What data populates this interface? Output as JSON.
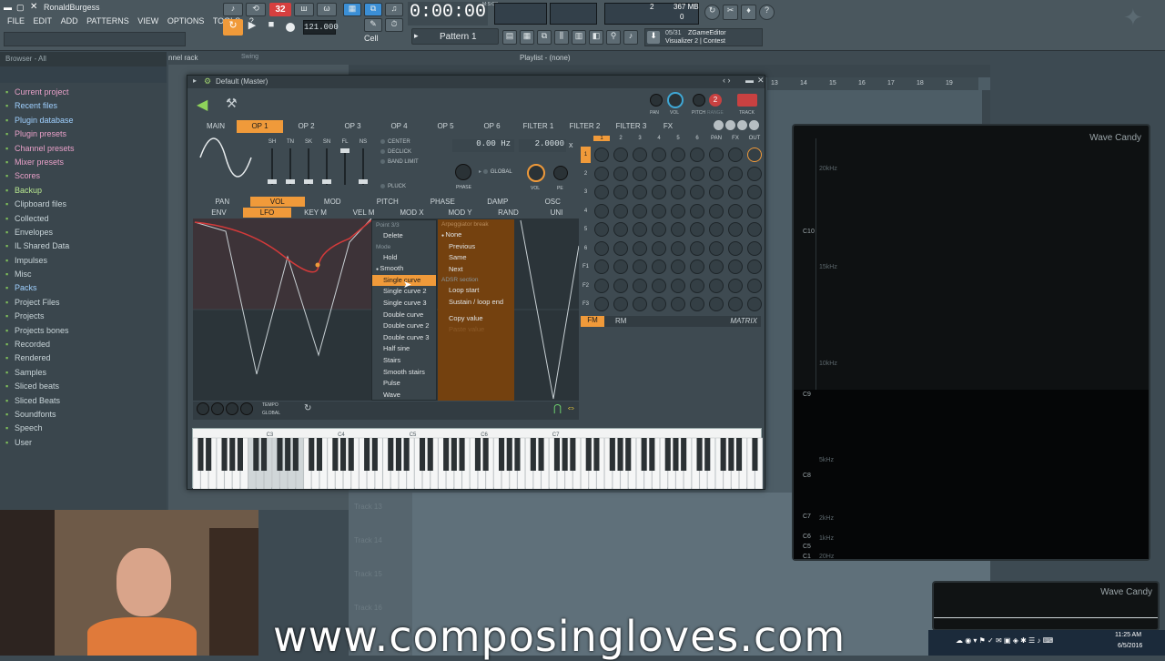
{
  "menu": [
    "FILE",
    "EDIT",
    "ADD",
    "PATTERNS",
    "VIEW",
    "OPTIONS",
    "TOOLS",
    "?"
  ],
  "user": "RonaldBurgess",
  "time": "0:00:00",
  "time_unit": "M:S:CS",
  "tempo": "121.000",
  "pattern": "Pattern 1",
  "snap": "Cell",
  "cpu": "2",
  "mem": "367 MB",
  "poly": "0",
  "hint_date": "05/31",
  "hint_line1": "ZGameEditor",
  "hint_line2": "Visualizer 2 | Contest",
  "step": "32",
  "browser": {
    "header": "Browser - All",
    "items": [
      {
        "label": "Current project",
        "color": "#e8a0c8"
      },
      {
        "label": "Recent files",
        "color": "#9fd0ff"
      },
      {
        "label": "Plugin database",
        "color": "#9fd0ff"
      },
      {
        "label": "Plugin presets",
        "color": "#e8a0c8"
      },
      {
        "label": "Channel presets",
        "color": "#e8a0c8"
      },
      {
        "label": "Mixer presets",
        "color": "#e8a0c8"
      },
      {
        "label": "Scores",
        "color": "#e8a0c8"
      },
      {
        "label": "Backup",
        "color": "#b8e890"
      },
      {
        "label": "Clipboard files",
        "color": "#c8d4d8"
      },
      {
        "label": "Collected",
        "color": "#c8d4d8"
      },
      {
        "label": "Envelopes",
        "color": "#c8d4d8"
      },
      {
        "label": "IL Shared Data",
        "color": "#c8d4d8"
      },
      {
        "label": "Impulses",
        "color": "#c8d4d8"
      },
      {
        "label": "Misc",
        "color": "#c8d4d8"
      },
      {
        "label": "Packs",
        "color": "#9fd0ff"
      },
      {
        "label": "Project Files",
        "color": "#c8d4d8"
      },
      {
        "label": "Projects",
        "color": "#c8d4d8"
      },
      {
        "label": "Projects bones",
        "color": "#c8d4d8"
      },
      {
        "label": "Recorded",
        "color": "#c8d4d8"
      },
      {
        "label": "Rendered",
        "color": "#c8d4d8"
      },
      {
        "label": "Samples",
        "color": "#c8d4d8"
      },
      {
        "label": "Sliced beats",
        "color": "#c8d4d8"
      },
      {
        "label": "Sliced Beats",
        "color": "#c8d4d8"
      },
      {
        "label": "Soundfonts",
        "color": "#c8d4d8"
      },
      {
        "label": "Speech",
        "color": "#c8d4d8"
      },
      {
        "label": "User",
        "color": "#c8d4d8"
      }
    ]
  },
  "channel_rack_title": "nnel rack",
  "swing": "Swing",
  "playlist_title": "Playlist - (none)",
  "playlist_bars": [
    "13",
    "14",
    "15",
    "16",
    "17",
    "18",
    "19"
  ],
  "tracks": [
    "Track 13",
    "Track 14",
    "Track 15",
    "Track 16"
  ],
  "plugin": {
    "title": "Default (Master)",
    "tabs": [
      "MAIN",
      "OP 1",
      "OP 2",
      "OP 3",
      "OP 4",
      "OP 5",
      "OP 6",
      "FILTER 1",
      "FILTER 2",
      "FILTER 3",
      "FX"
    ],
    "active_tab": "OP 1",
    "knob_labels": [
      "PAN",
      "VOL",
      "PITCH",
      "TRACK"
    ],
    "pitch_sub": "RANGE",
    "wave_labels": [
      "SH",
      "TN",
      "SK",
      "SN",
      "FL",
      "NS"
    ],
    "options": [
      "CENTER",
      "DECLICK",
      "BAND LIMIT",
      "PLUCK"
    ],
    "freq": "0.00 Hz",
    "ratio": "2.0000",
    "ratio_x": "x",
    "global": "GLOBAL",
    "phase": "PHASE",
    "vol": "VOL",
    "pe": "PE",
    "mod_row": [
      "PAN",
      "VOL",
      "MOD",
      "PITCH",
      "PHASE",
      "DAMP",
      "OSC"
    ],
    "env_row": [
      "ENV",
      "LFO",
      "KEY M",
      "VEL M",
      "MOD X",
      "MOD Y",
      "RAND",
      "UNI"
    ],
    "matrix_cols": [
      "1",
      "2",
      "3",
      "4",
      "5",
      "6",
      "PAN",
      "FX",
      "OUT"
    ],
    "matrix_rows": [
      "1",
      "2",
      "3",
      "4",
      "5",
      "6",
      "F1",
      "F2",
      "F3"
    ],
    "fm": "FM",
    "rm": "RM",
    "matrix": "MATRIX",
    "footer_left": [
      "TEMPO",
      "GLOBAL"
    ],
    "piano_labels": [
      "C3",
      "C4",
      "C5",
      "C6",
      "C7"
    ]
  },
  "ctx_menu": {
    "header": "Point 3/3",
    "col1": [
      {
        "t": "Delete",
        "type": "item"
      },
      {
        "t": "Mode",
        "type": "head"
      },
      {
        "t": "Hold",
        "type": "item"
      },
      {
        "t": "Smooth",
        "type": "item",
        "sel": true
      },
      {
        "t": "Single curve",
        "type": "item",
        "hl": true
      },
      {
        "t": "Single curve 2",
        "type": "item"
      },
      {
        "t": "Single curve 3",
        "type": "item"
      },
      {
        "t": "Double curve",
        "type": "item"
      },
      {
        "t": "Double curve 2",
        "type": "item"
      },
      {
        "t": "Double curve 3",
        "type": "item"
      },
      {
        "t": "Half sine",
        "type": "item"
      },
      {
        "t": "Stairs",
        "type": "item"
      },
      {
        "t": "Smooth stairs",
        "type": "item"
      },
      {
        "t": "Pulse",
        "type": "item"
      },
      {
        "t": "Wave",
        "type": "item"
      }
    ],
    "col2_header": "Arpeggiator break",
    "col2": [
      {
        "t": "None",
        "type": "item",
        "sel": true
      },
      {
        "t": "Previous",
        "type": "item"
      },
      {
        "t": "Same",
        "type": "item"
      },
      {
        "t": "Next",
        "type": "item"
      },
      {
        "t": "ADSR section",
        "type": "head"
      },
      {
        "t": "Loop start",
        "type": "item"
      },
      {
        "t": "Sustain / loop end",
        "type": "item"
      },
      {
        "t": "",
        "type": "sp"
      },
      {
        "t": "Copy value",
        "type": "item"
      },
      {
        "t": "Paste value",
        "type": "dis"
      }
    ]
  },
  "wave_candy": {
    "title": "Wave Candy",
    "freqs": [
      "20kHz",
      "15kHz",
      "10kHz",
      "5kHz",
      "2kHz",
      "1kHz",
      "20Hz"
    ],
    "notes": [
      "C10",
      "C9",
      "C8",
      "C7",
      "C6",
      "C5",
      "C1"
    ]
  },
  "wave_candy2": {
    "title": "Wave Candy"
  },
  "watermark": "www.composingloves.com",
  "clock": {
    "time": "11:25 AM",
    "date": "6/5/2016"
  }
}
